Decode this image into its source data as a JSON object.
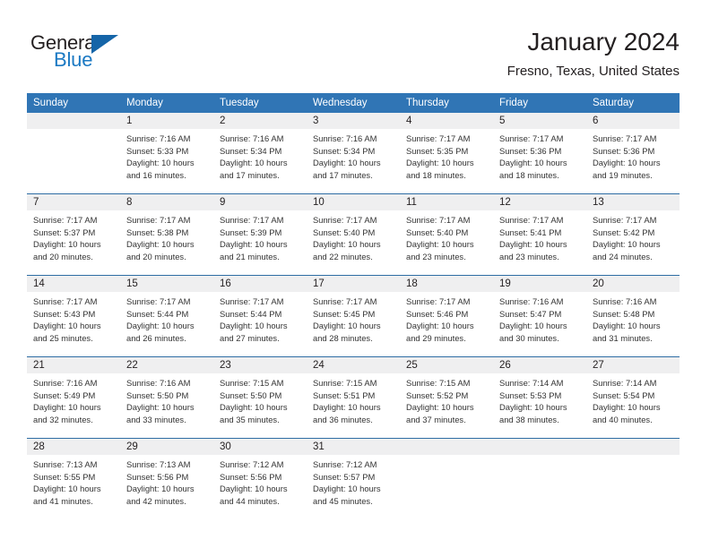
{
  "logo": {
    "word_top": "General",
    "word_bottom": "Blue",
    "triangle_color": "#1565a8",
    "blue_text_color": "#1b79c3"
  },
  "header": {
    "title": "January 2024",
    "subtitle": "Fresno, Texas, United States"
  },
  "theme": {
    "header_blue": "#3075b5",
    "separator_blue": "#2e6da4",
    "day_band_gray": "#efeff0"
  },
  "calendar": {
    "weekday_headers": [
      "Sunday",
      "Monday",
      "Tuesday",
      "Wednesday",
      "Thursday",
      "Friday",
      "Saturday"
    ],
    "weeks": [
      [
        {
          "day": "",
          "lines": []
        },
        {
          "day": "1",
          "lines": [
            "Sunrise: 7:16 AM",
            "Sunset: 5:33 PM",
            "Daylight: 10 hours",
            "and 16 minutes."
          ]
        },
        {
          "day": "2",
          "lines": [
            "Sunrise: 7:16 AM",
            "Sunset: 5:34 PM",
            "Daylight: 10 hours",
            "and 17 minutes."
          ]
        },
        {
          "day": "3",
          "lines": [
            "Sunrise: 7:16 AM",
            "Sunset: 5:34 PM",
            "Daylight: 10 hours",
            "and 17 minutes."
          ]
        },
        {
          "day": "4",
          "lines": [
            "Sunrise: 7:17 AM",
            "Sunset: 5:35 PM",
            "Daylight: 10 hours",
            "and 18 minutes."
          ]
        },
        {
          "day": "5",
          "lines": [
            "Sunrise: 7:17 AM",
            "Sunset: 5:36 PM",
            "Daylight: 10 hours",
            "and 18 minutes."
          ]
        },
        {
          "day": "6",
          "lines": [
            "Sunrise: 7:17 AM",
            "Sunset: 5:36 PM",
            "Daylight: 10 hours",
            "and 19 minutes."
          ]
        }
      ],
      [
        {
          "day": "7",
          "lines": [
            "Sunrise: 7:17 AM",
            "Sunset: 5:37 PM",
            "Daylight: 10 hours",
            "and 20 minutes."
          ]
        },
        {
          "day": "8",
          "lines": [
            "Sunrise: 7:17 AM",
            "Sunset: 5:38 PM",
            "Daylight: 10 hours",
            "and 20 minutes."
          ]
        },
        {
          "day": "9",
          "lines": [
            "Sunrise: 7:17 AM",
            "Sunset: 5:39 PM",
            "Daylight: 10 hours",
            "and 21 minutes."
          ]
        },
        {
          "day": "10",
          "lines": [
            "Sunrise: 7:17 AM",
            "Sunset: 5:40 PM",
            "Daylight: 10 hours",
            "and 22 minutes."
          ]
        },
        {
          "day": "11",
          "lines": [
            "Sunrise: 7:17 AM",
            "Sunset: 5:40 PM",
            "Daylight: 10 hours",
            "and 23 minutes."
          ]
        },
        {
          "day": "12",
          "lines": [
            "Sunrise: 7:17 AM",
            "Sunset: 5:41 PM",
            "Daylight: 10 hours",
            "and 23 minutes."
          ]
        },
        {
          "day": "13",
          "lines": [
            "Sunrise: 7:17 AM",
            "Sunset: 5:42 PM",
            "Daylight: 10 hours",
            "and 24 minutes."
          ]
        }
      ],
      [
        {
          "day": "14",
          "lines": [
            "Sunrise: 7:17 AM",
            "Sunset: 5:43 PM",
            "Daylight: 10 hours",
            "and 25 minutes."
          ]
        },
        {
          "day": "15",
          "lines": [
            "Sunrise: 7:17 AM",
            "Sunset: 5:44 PM",
            "Daylight: 10 hours",
            "and 26 minutes."
          ]
        },
        {
          "day": "16",
          "lines": [
            "Sunrise: 7:17 AM",
            "Sunset: 5:44 PM",
            "Daylight: 10 hours",
            "and 27 minutes."
          ]
        },
        {
          "day": "17",
          "lines": [
            "Sunrise: 7:17 AM",
            "Sunset: 5:45 PM",
            "Daylight: 10 hours",
            "and 28 minutes."
          ]
        },
        {
          "day": "18",
          "lines": [
            "Sunrise: 7:17 AM",
            "Sunset: 5:46 PM",
            "Daylight: 10 hours",
            "and 29 minutes."
          ]
        },
        {
          "day": "19",
          "lines": [
            "Sunrise: 7:16 AM",
            "Sunset: 5:47 PM",
            "Daylight: 10 hours",
            "and 30 minutes."
          ]
        },
        {
          "day": "20",
          "lines": [
            "Sunrise: 7:16 AM",
            "Sunset: 5:48 PM",
            "Daylight: 10 hours",
            "and 31 minutes."
          ]
        }
      ],
      [
        {
          "day": "21",
          "lines": [
            "Sunrise: 7:16 AM",
            "Sunset: 5:49 PM",
            "Daylight: 10 hours",
            "and 32 minutes."
          ]
        },
        {
          "day": "22",
          "lines": [
            "Sunrise: 7:16 AM",
            "Sunset: 5:50 PM",
            "Daylight: 10 hours",
            "and 33 minutes."
          ]
        },
        {
          "day": "23",
          "lines": [
            "Sunrise: 7:15 AM",
            "Sunset: 5:50 PM",
            "Daylight: 10 hours",
            "and 35 minutes."
          ]
        },
        {
          "day": "24",
          "lines": [
            "Sunrise: 7:15 AM",
            "Sunset: 5:51 PM",
            "Daylight: 10 hours",
            "and 36 minutes."
          ]
        },
        {
          "day": "25",
          "lines": [
            "Sunrise: 7:15 AM",
            "Sunset: 5:52 PM",
            "Daylight: 10 hours",
            "and 37 minutes."
          ]
        },
        {
          "day": "26",
          "lines": [
            "Sunrise: 7:14 AM",
            "Sunset: 5:53 PM",
            "Daylight: 10 hours",
            "and 38 minutes."
          ]
        },
        {
          "day": "27",
          "lines": [
            "Sunrise: 7:14 AM",
            "Sunset: 5:54 PM",
            "Daylight: 10 hours",
            "and 40 minutes."
          ]
        }
      ],
      [
        {
          "day": "28",
          "lines": [
            "Sunrise: 7:13 AM",
            "Sunset: 5:55 PM",
            "Daylight: 10 hours",
            "and 41 minutes."
          ]
        },
        {
          "day": "29",
          "lines": [
            "Sunrise: 7:13 AM",
            "Sunset: 5:56 PM",
            "Daylight: 10 hours",
            "and 42 minutes."
          ]
        },
        {
          "day": "30",
          "lines": [
            "Sunrise: 7:12 AM",
            "Sunset: 5:56 PM",
            "Daylight: 10 hours",
            "and 44 minutes."
          ]
        },
        {
          "day": "31",
          "lines": [
            "Sunrise: 7:12 AM",
            "Sunset: 5:57 PM",
            "Daylight: 10 hours",
            "and 45 minutes."
          ]
        },
        {
          "day": "",
          "lines": []
        },
        {
          "day": "",
          "lines": []
        },
        {
          "day": "",
          "lines": []
        }
      ]
    ]
  }
}
